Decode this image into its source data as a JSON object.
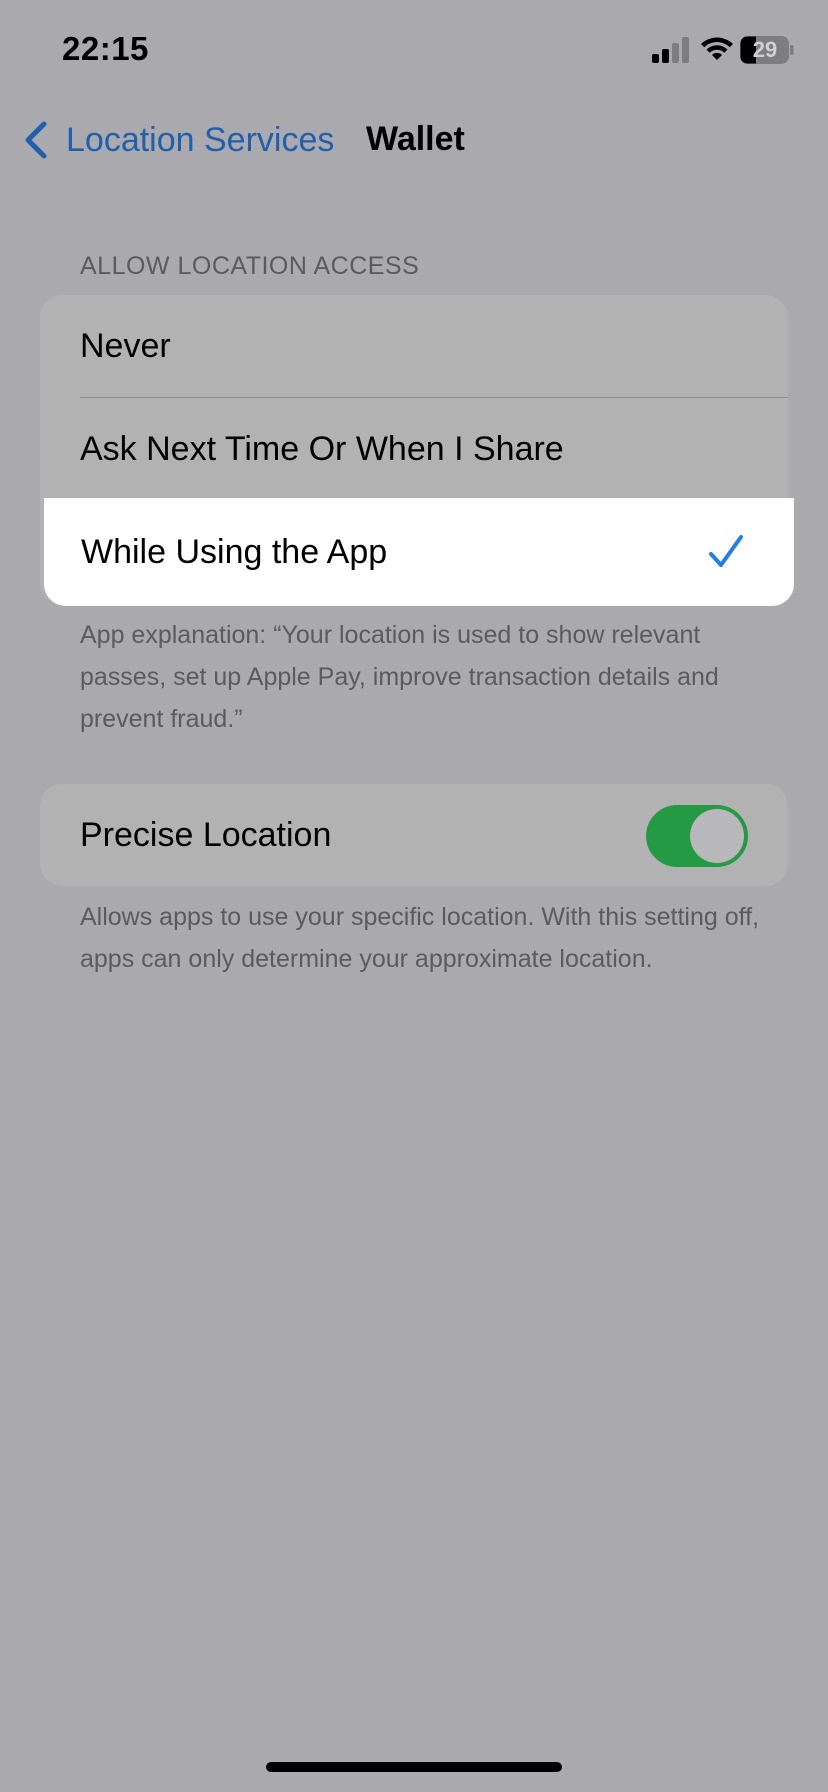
{
  "status_bar": {
    "time": "22:15",
    "battery_level": "29",
    "signal_icon": "cellular-signal-icon",
    "wifi_icon": "wifi-icon",
    "battery_icon": "battery-icon"
  },
  "nav": {
    "back_label": "Location Services",
    "back_icon": "chevron-left-icon",
    "title": "Wallet"
  },
  "location_access": {
    "header": "ALLOW LOCATION ACCESS",
    "options": [
      {
        "label": "Never",
        "selected": false
      },
      {
        "label": "Ask Next Time Or When I Share",
        "selected": false
      },
      {
        "label": "While Using the App",
        "selected": true
      }
    ],
    "check_icon": "checkmark-icon",
    "explanation": "App explanation: “Your location is used to show relevant passes, set up Apple Pay, improve transaction details and prevent fraud.”"
  },
  "precise_location": {
    "label": "Precise Location",
    "enabled": true,
    "footer": "Allows apps to use your specific location. With this setting off, apps can only determine your approximate location."
  },
  "colors": {
    "background": "#a9a9ae",
    "accent_blue": "#1f7ef0",
    "toggle_on": "#249a45"
  }
}
